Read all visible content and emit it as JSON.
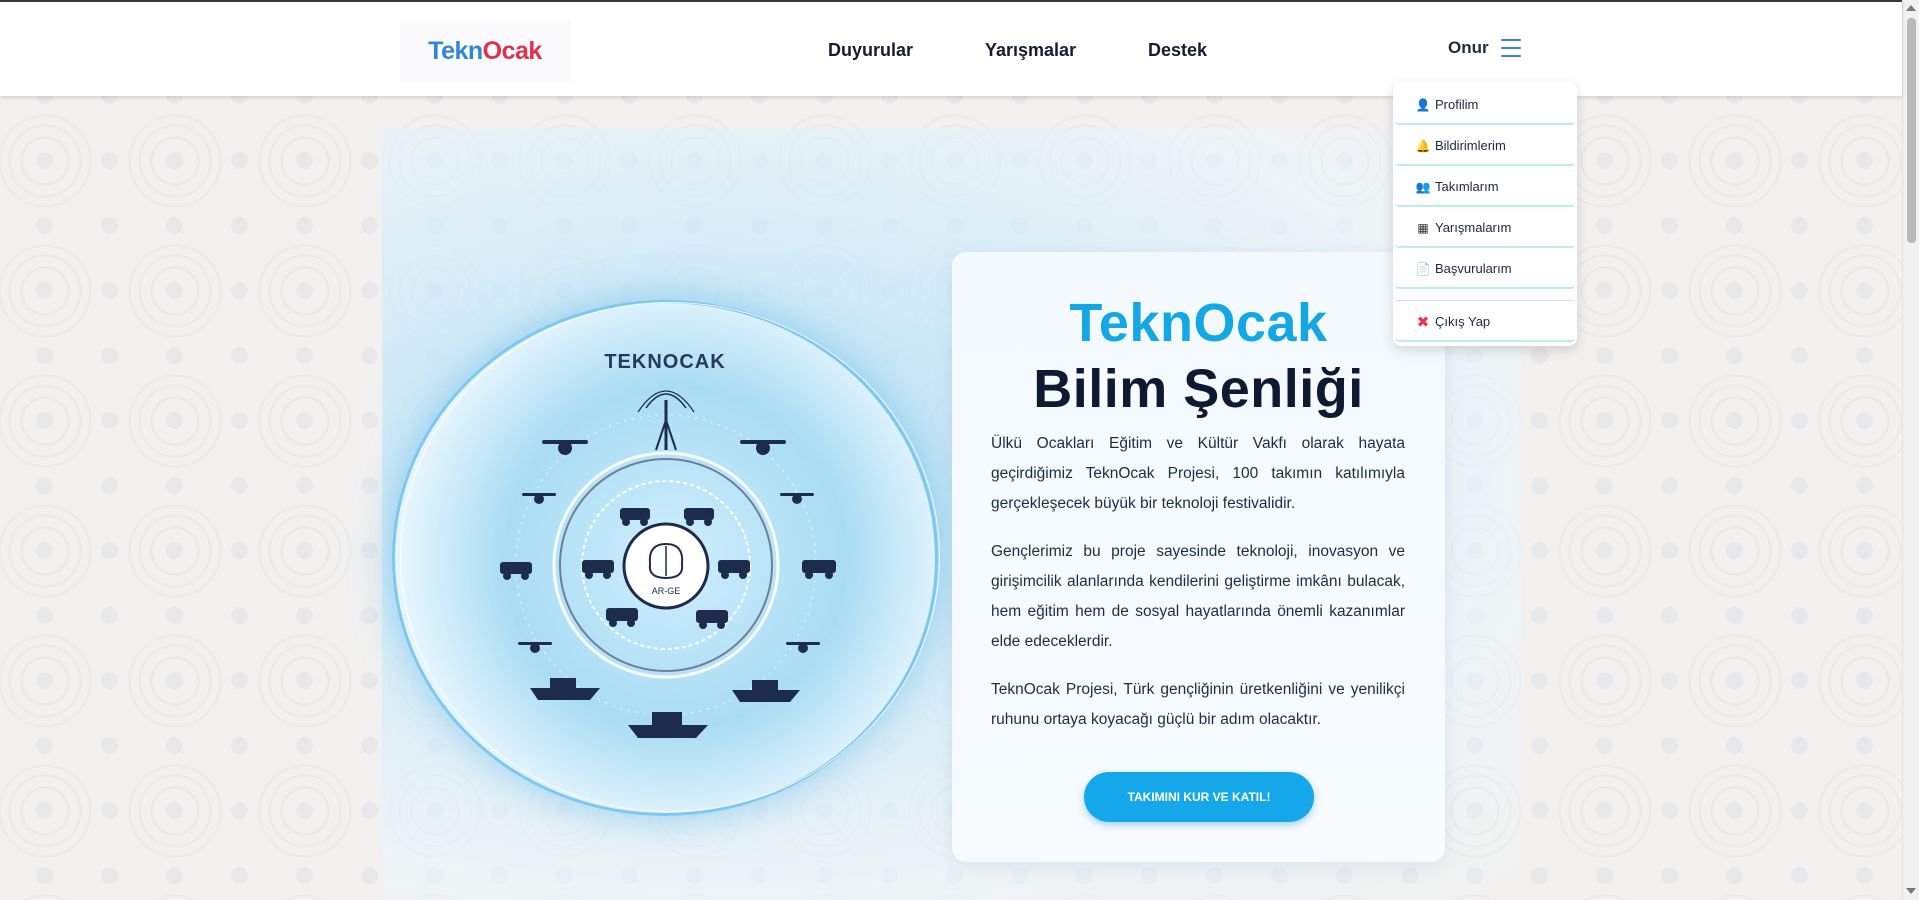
{
  "header": {
    "logo": {
      "part_a": "Tekn",
      "part_b": "Ocak"
    },
    "nav": [
      {
        "label": "Duyurular"
      },
      {
        "label": "Yarışmalar"
      },
      {
        "label": "Destek"
      }
    ],
    "user": {
      "name": "Onur",
      "menu_icon": "hamburger-icon"
    }
  },
  "dropdown": {
    "items": [
      {
        "label": "Profilim",
        "icon": "user-icon"
      },
      {
        "label": "Bildirimlerim",
        "icon": "bell-icon"
      },
      {
        "label": "Takımlarım",
        "icon": "team-icon"
      },
      {
        "label": "Yarışmalarım",
        "icon": "checkered-flag-icon"
      },
      {
        "label": "Başvurularım",
        "icon": "document-icon"
      }
    ],
    "logout": {
      "label": "Çıkış Yap",
      "icon": "close-icon"
    }
  },
  "hero": {
    "illustration": {
      "title": "TEKNOCAK",
      "center_label": "AR-GE"
    },
    "title_line1": "TeknOcak",
    "title_line2": "Bilim Şenliği",
    "paragraphs": [
      "Ülkü Ocakları Eğitim ve Kültür Vakfı olarak hayata geçirdiğimiz TeknOcak Projesi, 100 takımın katılımıyla gerçekleşecek büyük bir teknoloji festivalidir.",
      "Gençlerimiz bu proje sayesinde teknoloji, inovasyon ve girişimcilik alanlarında kendilerini geliştirme imkânı bulacak, hem eğitim hem de sosyal hayatlarında önemli kazanımlar elde edeceklerdir.",
      "TeknOcak Projesi, Türk gençliğinin üretkenliğini ve yenilikçi ruhunu ortaya koyacağı güçlü bir adım olacaktır."
    ],
    "cta_label": "TAKIMINI KUR VE KATIL!"
  },
  "colors": {
    "accent": "#14a8ea",
    "title_dark": "#0e1a32",
    "logo_blue": "#2f86d6",
    "logo_red": "#e0304a",
    "dropdown_divider": "#b9f0de"
  }
}
